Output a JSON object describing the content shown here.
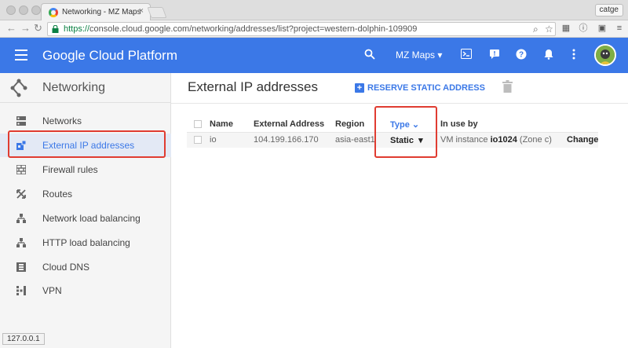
{
  "browser": {
    "tab_title": "Networking - MZ Maps",
    "tab_close": "×",
    "profile": "catge",
    "url_scheme": "https://",
    "url_rest": "console.cloud.google.com/networking/addresses/list?project=western-dolphin-109909",
    "status": "127.0.0.1"
  },
  "header": {
    "brand": "Google Cloud Platform",
    "project": "MZ Maps",
    "project_caret": "▾"
  },
  "sidebar": {
    "title": "Networking",
    "items": [
      {
        "label": "Networks"
      },
      {
        "label": "External IP addresses"
      },
      {
        "label": "Firewall rules"
      },
      {
        "label": "Routes"
      },
      {
        "label": "Network load balancing"
      },
      {
        "label": "HTTP load balancing"
      },
      {
        "label": "Cloud DNS"
      },
      {
        "label": "VPN"
      }
    ]
  },
  "main": {
    "title": "External IP addresses",
    "reserve_label": "RESERVE STATIC ADDRESS",
    "columns": {
      "name": "Name",
      "address": "External Address",
      "region": "Region",
      "type": "Type",
      "type_caret": "⌄",
      "in_use": "In use by"
    },
    "row": {
      "name": "io",
      "address": "104.199.166.170",
      "region": "asia-east1",
      "type": "Static",
      "type_caret": "▾",
      "vm_prefix": "VM instance ",
      "vm_name": "io1024",
      "vm_zone": " (Zone c)",
      "action": "Change"
    }
  },
  "colors": {
    "accent": "#3b78e7",
    "highlight": "#e03c31"
  }
}
